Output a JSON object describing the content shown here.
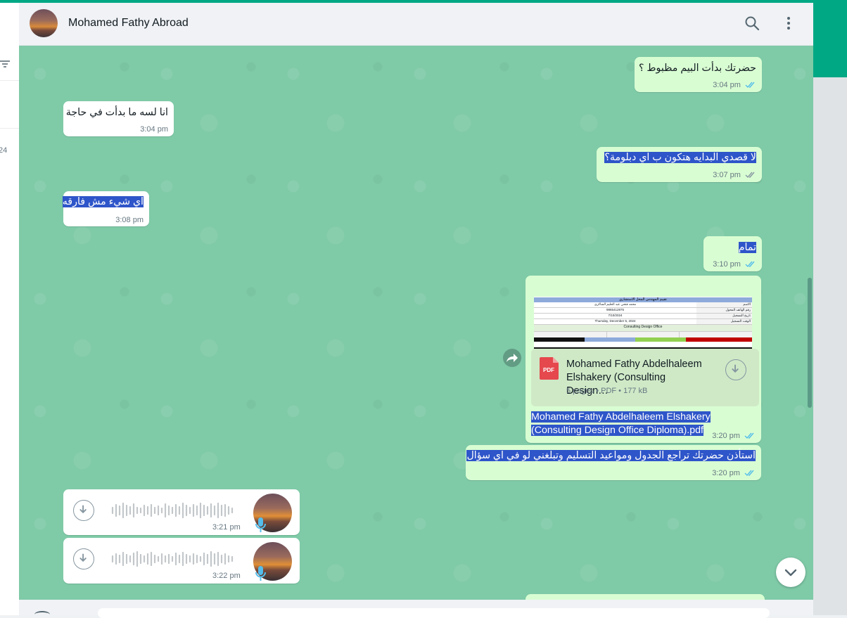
{
  "header": {
    "contact_name": "Mohamed Fathy Abroad",
    "icons": [
      "search-icon",
      "menu-icon"
    ]
  },
  "left_pane": {
    "fragment": "24"
  },
  "messages": [
    {
      "id": "m1",
      "direction": "out",
      "text": "حضرتك بدأت البيم مظبوط ؟",
      "time": "3:04 pm",
      "status": "read"
    },
    {
      "id": "m2",
      "direction": "in",
      "text": "انا لسه ما بدأت في حاجة",
      "time": "3:04 pm"
    },
    {
      "id": "m3",
      "direction": "out",
      "text": "لا قصدي البدايه هتكون ب اي دبلومة؟",
      "time": "3:07 pm",
      "status": "delivered",
      "selected": true
    },
    {
      "id": "m4",
      "direction": "in",
      "text": "اي شيء مش فارقه",
      "time": "3:08 pm",
      "selected": true
    },
    {
      "id": "m5",
      "direction": "out",
      "text": "تمام",
      "time": "3:10 pm",
      "status": "read",
      "selected": true
    },
    {
      "id": "m6",
      "direction": "out",
      "type": "document",
      "file_title": "Mohamed Fathy Abdelhaleem Elshakery (Consulting Design…",
      "file_meta": "5 pages • PDF • 177 kB",
      "file_badge": "PDF",
      "caption_line1": "Mohamed Fathy Abdelhaleem Elshakery",
      "caption_line2": "(Consulting Design Office Diploma).pdf",
      "time": "3:20 pm",
      "status": "read",
      "preview": {
        "title": "تقييم المهندس المحل الاستشاري",
        "rows": [
          {
            "label": "الاسم",
            "value": "محمد فتحي عبد الحليم الشاكري"
          },
          {
            "label": "رقم الهاتف المحول",
            "value": "9865412875"
          },
          {
            "label": "تاريخ التسجيل",
            "value": "7/10/2024"
          },
          {
            "label": "الوقت التسجيل",
            "value": "Thursday, December 5, 2024"
          }
        ],
        "section": "Consulting Design Office"
      }
    },
    {
      "id": "m7",
      "direction": "out",
      "text": "استأذن حضرتك تراجع الجدول ومواعيد التسليم وتبلغني لو في اي سؤال",
      "time": "3:20 pm",
      "status": "read",
      "selected": true
    },
    {
      "id": "m8",
      "direction": "in",
      "type": "voice",
      "time": "3:21 pm"
    },
    {
      "id": "m9",
      "direction": "in",
      "type": "voice",
      "time": "3:22 pm"
    }
  ],
  "colors": {
    "accent": "#00a884",
    "chat_bg": "#7fcaa7",
    "outgoing": "#d9fdd3",
    "incoming": "#ffffff",
    "selection": "#2e55c9",
    "read_tick": "#53bdeb"
  }
}
